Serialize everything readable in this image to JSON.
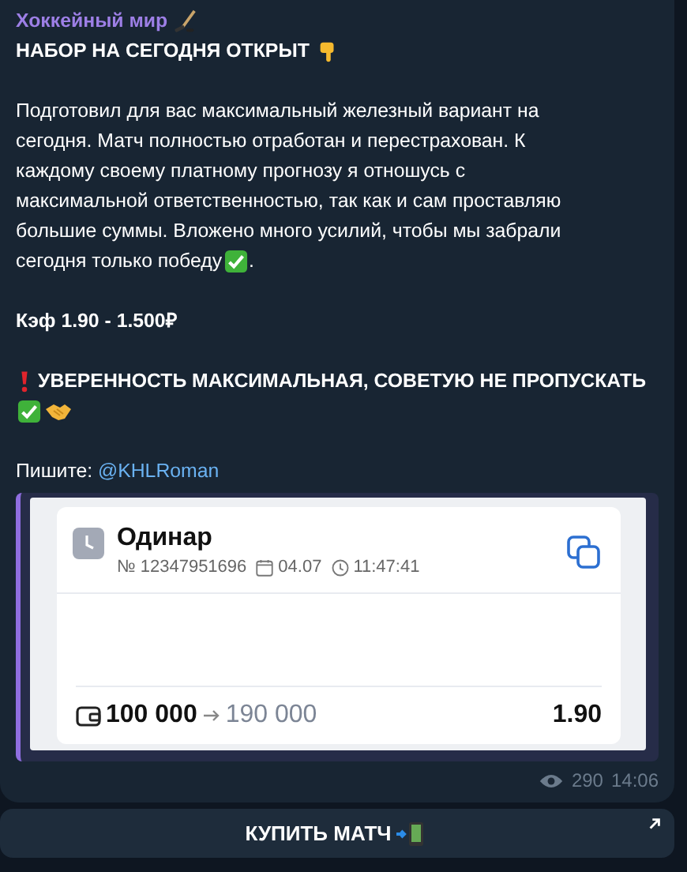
{
  "message": {
    "author": "Хоккейный мир",
    "headline": "НАБОР НА СЕГОДНЯ ОТКРЫТ",
    "body_lines": [
      "Подготовил для вас максимальный железный вариант на",
      "сегодня. Матч полностью отработан и перестрахован. К",
      "каждому своему платному прогнозу я отношусь с",
      "максимальной ответственностью, так как и сам проставляю",
      "большие суммы. Вложено много усилий, чтобы мы забрали",
      "сегодня только победу"
    ],
    "body_end": ".",
    "odds": "Кэф 1.90 - 1.500₽",
    "warning": "УВЕРЕННОСТЬ МАКСИМАЛЬНАЯ, СОВЕТУЮ НЕ ПРОПУСКАТЬ",
    "contact_label": "Пишите:",
    "contact_link": "@KHLRoman",
    "ticket": {
      "title": "Одинар",
      "number": "№ 12347951696",
      "date": "04.07",
      "time": "11:47:41",
      "stake": "100 000",
      "payout": "190 000",
      "odds": "1.90"
    },
    "views": "290",
    "time": "14:06"
  },
  "button": {
    "label": "КУПИТЬ МАТЧ"
  }
}
